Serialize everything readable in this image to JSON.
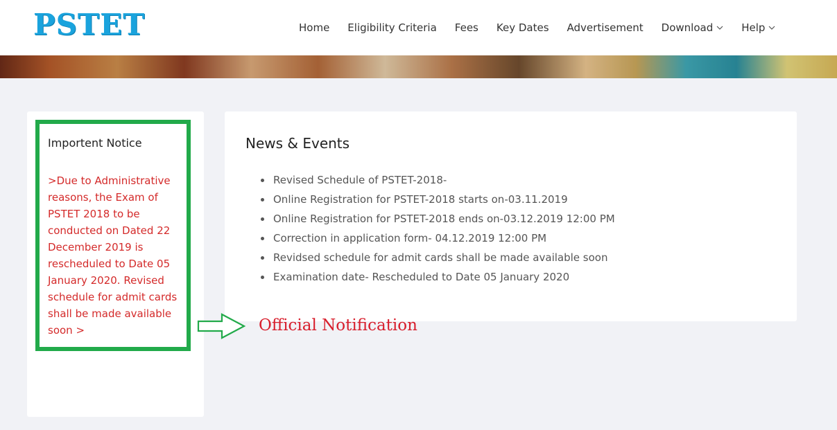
{
  "logo": {
    "text": "PSTET"
  },
  "nav": {
    "items": [
      {
        "label": "Home"
      },
      {
        "label": "Eligibility Criteria"
      },
      {
        "label": "Fees"
      },
      {
        "label": "Key Dates"
      },
      {
        "label": "Advertisement"
      },
      {
        "label": "Download",
        "has_dropdown": true,
        "icon": "chevron-down-icon"
      },
      {
        "label": "Help",
        "has_dropdown": true,
        "icon": "chevron-down-icon"
      }
    ]
  },
  "notice": {
    "title": "Importent Notice",
    "text": " >Due to Administrative reasons, the Exam of PSTET 2018 to be conducted on Dated 22 December 2019 is rescheduled to Date 05 January 2020. Revised schedule for admit cards shall be made available soon >"
  },
  "news": {
    "title": "News & Events",
    "items": [
      "Revised Schedule of PSTET-2018-",
      "Online Registration for PSTET-2018 starts on-03.11.2019",
      "Online Registration for PSTET-2018 ends on-03.12.2019 12:00 PM",
      "Correction in application form- 04.12.2019 12:00 PM",
      "Revidsed schedule for admit cards shall be made available soon",
      "Examination date- Rescheduled to Date 05 January 2020"
    ]
  },
  "annotation": {
    "label": "Official Notification",
    "icon": "arrow-right-icon"
  },
  "colors": {
    "logo": "#1aa3dd",
    "notice_border": "#22aa4a",
    "notice_text": "#d42a2a",
    "annotation": "#d81e2c",
    "background": "#f1f2f6"
  }
}
